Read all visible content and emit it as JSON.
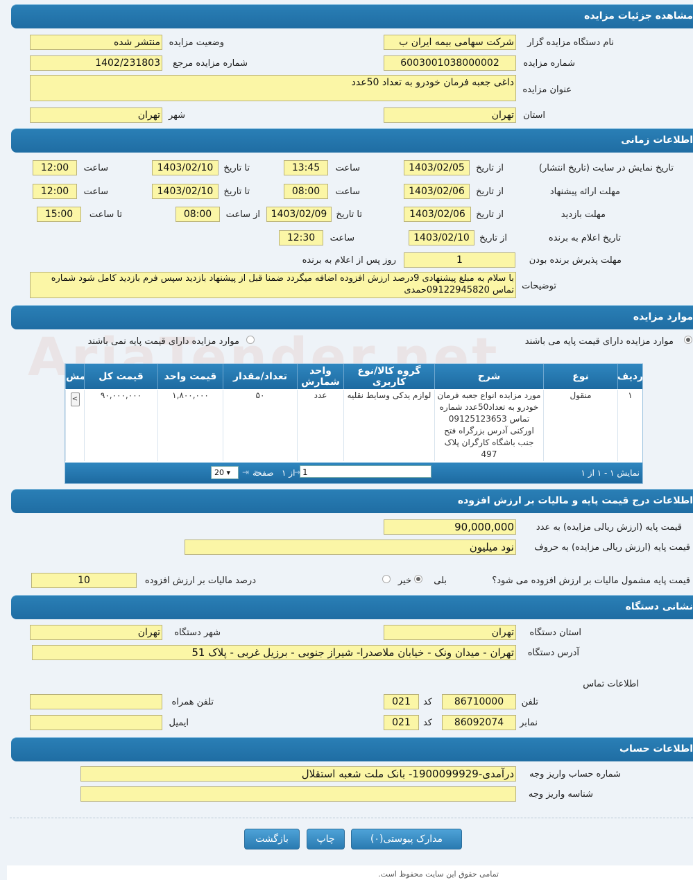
{
  "sections": {
    "details": "مشاهده جزئیات مزایده",
    "timing": "اطلاعات زمانی",
    "items": "موارد مزایده",
    "pricing": "اطلاعات درج قیمت پایه و مالیات بر ارزش افزوده",
    "address": "نشانی دستگاه",
    "account": "اطلاعات حساب"
  },
  "details": {
    "org_label": "نام دستگاه مزایده گزار",
    "org_value": "شرکت سهامی بیمه ایران ب",
    "status_label": "وضعیت مزایده",
    "status_value": "منتشر شده",
    "number_label": "شماره مزایده",
    "number_value": "6003001038000002",
    "ref_label": "شماره مزایده مرجع",
    "ref_value": "1402/231803",
    "title_label": "عنوان مزایده",
    "title_value": "داغی جعبه فرمان خودرو به تعداد 50عدد",
    "province_label": "استان",
    "province_value": "تهران",
    "city_label": "شهر",
    "city_value": "تهران"
  },
  "timing": {
    "display_label": "تاریخ نمایش در سایت (تاریخ انتشار)",
    "offer_label": "مهلت ارائه پیشنهاد",
    "visit_label": "مهلت بازدید",
    "announce_label": "تاریخ اعلام به برنده",
    "accept_label": "مهلت پذیرش برنده بودن",
    "from_date": "از تاریخ",
    "to_date": "تا تاریخ",
    "hour": "ساعت",
    "from_hour": "از ساعت",
    "to_hour": "تا ساعت",
    "days_after": "روز پس از اعلام به برنده",
    "display": {
      "from_date": "1403/02/05",
      "from_time": "13:45",
      "to_date": "1403/02/10",
      "to_time": "12:00"
    },
    "offer": {
      "from_date": "1403/02/06",
      "from_time": "08:00",
      "to_date": "1403/02/10",
      "to_time": "12:00"
    },
    "visit": {
      "from_date": "1403/02/06",
      "to_date": "1403/02/09",
      "from_time": "08:00",
      "to_time": "15:00"
    },
    "announce": {
      "date": "1403/02/10",
      "time": "12:30"
    },
    "accept_days": "1",
    "notes_label": "توضیحات",
    "notes_value": "با سلام به مبلغ پیشنهادی 9درصد ارزش افزوده اضافه میگردد ضمنا قبل از پیشنهاد بازدید سپس فرم بازدید کامل شود شماره تماس 09122945820حمدی"
  },
  "items": {
    "radio_with_base": "موارد مزایده دارای قیمت پایه می باشند",
    "radio_without_base": "موارد مزایده دارای قیمت پایه نمی باشند",
    "columns": [
      "ردیف",
      "نوع",
      "شرح",
      "گروه کالا/نوع کاربری",
      "واحد شمارش",
      "تعداد/مقدار",
      "قیمت واحد",
      "قیمت کل",
      "مش"
    ],
    "rows": [
      {
        "row": "۱",
        "type": "منقول",
        "desc": "مورد مزایده انواع جعبه فرمان خودرو به تعداد50عدد شماره تماس 09125123653 اورکنی آدرس بزرگراه فتح جنب باشگاه کارگران پلاک 497",
        "group": "لوازم یدکی وسایط نقلیه",
        "unit": "عدد",
        "qty": "۵۰",
        "unit_price": "۱,۸۰۰,۰۰۰",
        "total": "۹۰,۰۰۰,۰۰۰"
      }
    ],
    "pager": {
      "page_label": "صفحه",
      "page_value": "1",
      "of_label": "از ۱",
      "page_size": "20",
      "summary": "نمایش ۱ - ۱ از ۱"
    }
  },
  "pricing": {
    "base_num_label": "قیمت پایه (ارزش ریالی مزایده) به عدد",
    "base_num_value": "90,000,000",
    "base_word_label": "قیمت پایه (ارزش ریالی مزایده) به حروف",
    "base_word_value": "نود میلیون",
    "vat_question": "قیمت پایه مشمول مالیات بر ارزش افزوده می شود؟",
    "yes": "بلی",
    "no": "خیر",
    "vat_percent_label": "درصد مالیات بر ارزش افزوده",
    "vat_percent_value": "10"
  },
  "address": {
    "province_label": "استان دستگاه",
    "province_value": "تهران",
    "city_label": "شهر دستگاه",
    "city_value": "تهران",
    "addr_label": "آدرس دستگاه",
    "addr_value": "تهران - میدان ونک - خیابان ملاصدرا- شیراز جنوبی - برزیل غربی - پلاک 51",
    "contact_label": "اطلاعات تماس",
    "phone_label": "تلفن",
    "phone_value": "86710000",
    "code_label": "کد",
    "phone_code": "021",
    "mobile_label": "تلفن همراه",
    "mobile_value": "",
    "fax_label": "نمابر",
    "fax_value": "86092074",
    "fax_code": "021",
    "email_label": "ایمیل",
    "email_value": ""
  },
  "account": {
    "acc_label": "شماره حساب واریز وجه",
    "acc_value": "درآمدی-1900099929- بانک ملت شعبه استقلال",
    "id_label": "شناسه واریز وجه",
    "id_value": ""
  },
  "buttons": {
    "attachments": "مدارک پیوستی(۰)",
    "print": "چاپ",
    "back": "بازگشت"
  },
  "footer": "تمامی حقوق این سایت محفوظ است.",
  "watermark": "AriaTender.net"
}
